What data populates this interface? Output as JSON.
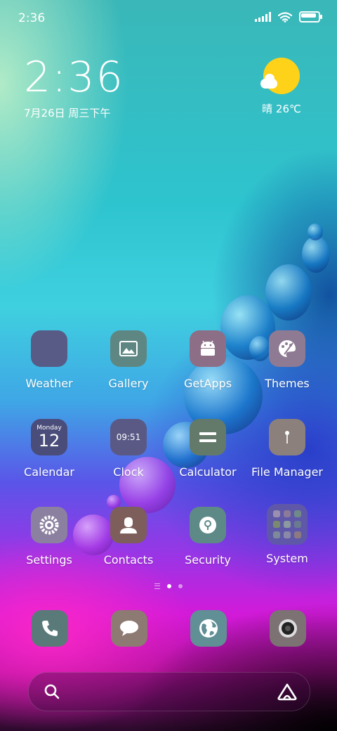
{
  "status_bar": {
    "time": "2:36"
  },
  "clock_widget": {
    "time": "2:36",
    "date": "7月26日 周三下午"
  },
  "weather_widget": {
    "text": "晴 26℃"
  },
  "apps": [
    {
      "label": "Weather",
      "icon": "weather-icon",
      "color": "#585b86"
    },
    {
      "label": "Gallery",
      "icon": "gallery-icon",
      "color": "#5e8784"
    },
    {
      "label": "GetApps",
      "icon": "getapps-icon",
      "color": "#8c6f86"
    },
    {
      "label": "Themes",
      "icon": "themes-icon",
      "color": "#8f7a93"
    },
    {
      "label": "Calendar",
      "icon": "calendar-icon",
      "color": "#4a4c7a",
      "badge_top": "Monday",
      "badge_num": "12"
    },
    {
      "label": "Clock",
      "icon": "clock-icon",
      "color": "#5a5986",
      "badge_num": "09:51"
    },
    {
      "label": "Calculator",
      "icon": "calculator-icon",
      "color": "#637a6a"
    },
    {
      "label": "File Manager",
      "icon": "file-manager-icon",
      "color": "#8c807c"
    },
    {
      "label": "Settings",
      "icon": "settings-icon",
      "color": "#8c80a0"
    },
    {
      "label": "Contacts",
      "icon": "contacts-icon",
      "color": "#7e5e5a"
    },
    {
      "label": "Security",
      "icon": "security-icon",
      "color": "#5d8a86"
    },
    {
      "label": "System",
      "icon": "system-folder-icon",
      "color": "#5f58a8"
    }
  ],
  "dock": [
    {
      "icon": "phone-icon",
      "color": "#5a7a7a"
    },
    {
      "icon": "messages-icon",
      "color": "#8d7a72"
    },
    {
      "icon": "browser-icon",
      "color": "#618f96"
    },
    {
      "icon": "camera-icon",
      "color": "#7c7274"
    }
  ]
}
